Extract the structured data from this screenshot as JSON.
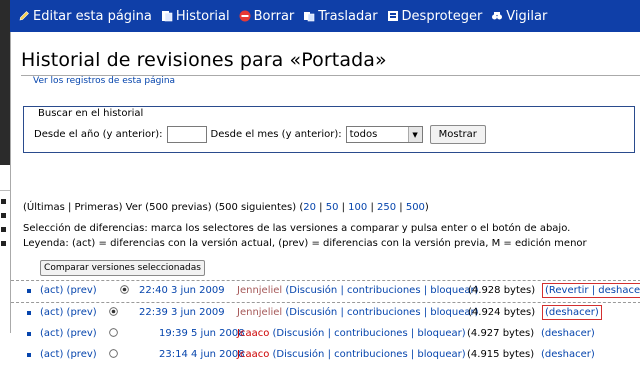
{
  "tabs": [
    {
      "label": "Editar esta página",
      "icon": "pencil-icon"
    },
    {
      "label": "Historial",
      "icon": "history-icon"
    },
    {
      "label": "Borrar",
      "icon": "delete-icon"
    },
    {
      "label": "Trasladar",
      "icon": "move-icon"
    },
    {
      "label": "Desproteger",
      "icon": "unprotect-icon"
    },
    {
      "label": "Vigilar",
      "icon": "watch-icon"
    }
  ],
  "page_title": "Historial de revisiones para «Portada»",
  "subtitle": "Ver los registros de esta página",
  "search": {
    "legend": "Buscar en el historial",
    "year_label": "Desde el año (y anterior):",
    "year_value": "",
    "month_label": "Desde el mes (y anterior):",
    "month_value": "todos",
    "submit": "Mostrar"
  },
  "nav": {
    "prefix": "(Últimas | Primeras) Ver (500 previas) (500 siguientes) (",
    "limits": [
      "20",
      "50",
      "100",
      "250",
      "500"
    ],
    "suffix": ")"
  },
  "diff_help": {
    "line1": "Selección de diferencias: marca los selectores de las versiones a comparar y pulsa enter o el botón de abajo.",
    "line2": "Leyenda: (act) = diferencias con la versión actual, (prev) = diferencias con la versión previa, M = edición menor"
  },
  "compare_button": "Comparar versiones seleccionadas",
  "revisions": [
    {
      "act": "(act)",
      "prev": "(prev)",
      "time": "22:40 3 jun 2009",
      "user": "Jennjeliel",
      "links": "(Discusión | contribuciones | bloquear)",
      "size": "(4.928 bytes)",
      "undo": "(Revertir | deshacer)"
    },
    {
      "act": "(act)",
      "prev": "(prev)",
      "time": "22:39 3 jun 2009",
      "user": "Jennjeliel",
      "links": "(Discusión | contribuciones | bloquear)",
      "size": "(4.924 bytes)",
      "undo": "(deshacer)"
    },
    {
      "act": "(act)",
      "prev": "(prev)",
      "time": "19:39 5 jun 2008",
      "user": "Jcaaco",
      "links": "(Discusión | contribuciones | bloquear)",
      "size": "(4.927 bytes)",
      "undo": "(deshacer)"
    },
    {
      "act": "(act)",
      "prev": "(prev)",
      "time": "23:14 4 jun 2008",
      "user": "Jcaaco",
      "links": "(Discusión | contribuciones | bloquear)",
      "size": "(4.915 bytes)",
      "undo": "(deshacer)"
    }
  ],
  "colors": {
    "tabbar": "#0f3fa8",
    "link": "#0645ad",
    "new_user": "#cc0000",
    "highlight": "#d32f2f"
  }
}
